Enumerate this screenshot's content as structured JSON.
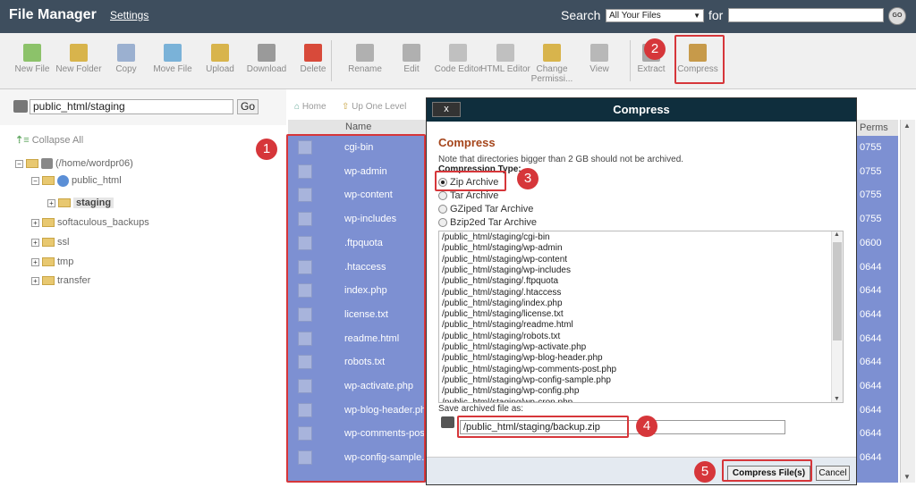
{
  "header": {
    "title": "File Manager",
    "settings": "Settings",
    "search_label": "Search",
    "search_scope": "All Your Files",
    "for_label": "for",
    "go": "GO"
  },
  "toolbar": [
    {
      "label": "New File",
      "icon": "new-file-icon",
      "color": "#8cc26a"
    },
    {
      "label": "New Folder",
      "icon": "new-folder-icon",
      "color": "#d8b44c"
    },
    {
      "label": "Copy",
      "icon": "copy-icon",
      "color": "#9bb0d0"
    },
    {
      "label": "Move File",
      "icon": "move-file-icon",
      "color": "#7ab2d8"
    },
    {
      "label": "Upload",
      "icon": "upload-icon",
      "color": "#d8b44c"
    },
    {
      "label": "Download",
      "icon": "download-icon",
      "color": "#9a9a9a"
    },
    {
      "label": "Delete",
      "icon": "delete-icon",
      "color": "#d84a3a"
    },
    {
      "label": "Rename",
      "icon": "rename-icon",
      "color": "#b0b0b0"
    },
    {
      "label": "Edit",
      "icon": "edit-icon",
      "color": "#b0b0b0"
    },
    {
      "label": "Code Editor",
      "icon": "code-editor-icon",
      "color": "#c0c0c0"
    },
    {
      "label": "HTML Editor",
      "icon": "html-editor-icon",
      "color": "#c0c0c0"
    },
    {
      "label": "Change Permissi...",
      "icon": "permissions-icon",
      "color": "#d8b44c"
    },
    {
      "label": "View",
      "icon": "view-icon",
      "color": "#b8b8b8"
    },
    {
      "label": "Extract",
      "icon": "extract-icon",
      "color": "#a8a8a8"
    },
    {
      "label": "Compress",
      "icon": "compress-icon",
      "color": "#c79a4a"
    }
  ],
  "path_bar": {
    "path": "public_html/staging",
    "go": "Go"
  },
  "tree": {
    "collapse_all": "Collapse All",
    "root": "(/home/wordpr06)",
    "public_html": "public_html",
    "staging": "staging",
    "softaculous_backups": "softaculous_backups",
    "ssl": "ssl",
    "tmp": "tmp",
    "transfer": "transfer"
  },
  "file_list": {
    "home": "Home",
    "up_one_level": "Up One Level",
    "col_name": "Name",
    "col_perms": "Perms",
    "rows": [
      {
        "name": "cgi-bin",
        "perms": "0755"
      },
      {
        "name": "wp-admin",
        "perms": "0755"
      },
      {
        "name": "wp-content",
        "perms": "0755"
      },
      {
        "name": "wp-includes",
        "perms": "0755"
      },
      {
        "name": ".ftpquota",
        "perms": "0600"
      },
      {
        "name": ".htaccess",
        "perms": "0644"
      },
      {
        "name": "index.php",
        "perms": "0644"
      },
      {
        "name": "license.txt",
        "perms": "0644"
      },
      {
        "name": "readme.html",
        "perms": "0644"
      },
      {
        "name": "robots.txt",
        "perms": "0644"
      },
      {
        "name": "wp-activate.php",
        "perms": "0644"
      },
      {
        "name": "wp-blog-header.ph",
        "perms": "0644"
      },
      {
        "name": "wp-comments-pos",
        "perms": "0644"
      },
      {
        "name": "wp-config-sample.",
        "perms": "0644"
      }
    ]
  },
  "dialog": {
    "title": "Compress",
    "close": "x",
    "heading": "Compress",
    "note": "Note that directories bigger than 2 GB should not be archived.",
    "compression_type_label": "Compression Type:",
    "options": [
      {
        "label": "Zip Archive",
        "selected": true
      },
      {
        "label": "Tar Archive",
        "selected": false
      },
      {
        "label": "GZiped Tar Archive",
        "selected": false
      },
      {
        "label": "Bzip2ed Tar Archive",
        "selected": false
      }
    ],
    "files": [
      "/public_html/staging/cgi-bin",
      "/public_html/staging/wp-admin",
      "/public_html/staging/wp-content",
      "/public_html/staging/wp-includes",
      "/public_html/staging/.ftpquota",
      "/public_html/staging/.htaccess",
      "/public_html/staging/index.php",
      "/public_html/staging/license.txt",
      "/public_html/staging/readme.html",
      "/public_html/staging/robots.txt",
      "/public_html/staging/wp-activate.php",
      "/public_html/staging/wp-blog-header.php",
      "/public_html/staging/wp-comments-post.php",
      "/public_html/staging/wp-config-sample.php",
      "/public_html/staging/wp-config.php",
      "/public_html/staging/wp-cron.php"
    ],
    "save_label": "Save archived file as:",
    "save_path": "/public_html/staging/backup.zip",
    "compress_button": "Compress File(s)",
    "cancel_button": "Cancel"
  },
  "annotations": [
    "1",
    "2",
    "3",
    "4",
    "5"
  ],
  "colors": {
    "highlight": "#d6363a",
    "selection": "#7d90d2",
    "dialog_title_bg": "#0f2e3d",
    "heading": "#a5451b"
  }
}
